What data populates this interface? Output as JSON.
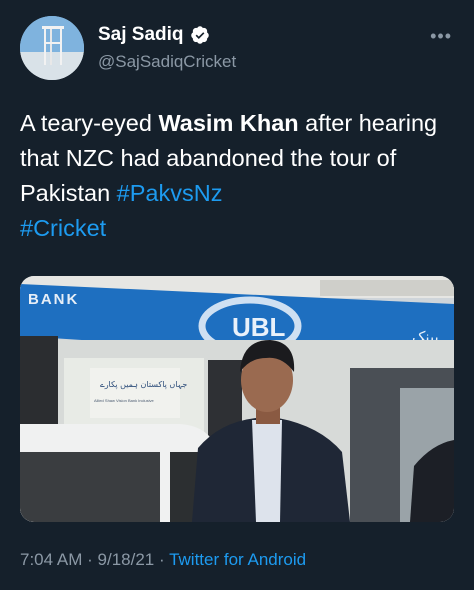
{
  "user": {
    "name": "Saj Sadiq",
    "handle": "@SajSadiqCricket",
    "verified": true
  },
  "tweet": {
    "text_before": "A teary-eyed ",
    "bold_name": "Wasim Khan",
    "text_after": " after hearing that NZC had abandoned the tour of Pakistan ",
    "hashtag1": "#PakvsNz",
    "hashtag2": "#Cricket"
  },
  "media": {
    "sign_bank": "BANK",
    "sign_logo": "UBL",
    "banner_urdu": "جہاں پاکستان ہمیں پکارے",
    "banner_line2": "Allied Shaw Vision Bank Inclusive"
  },
  "footer": {
    "time": "7:04 AM",
    "date": "9/18/21",
    "source": "Twitter for Android",
    "separator": "·"
  },
  "colors": {
    "background": "#15202b",
    "link": "#1d9bf0",
    "secondary_text": "#8b98a5"
  },
  "icons": [
    "verified-badge-icon",
    "more-icon"
  ]
}
